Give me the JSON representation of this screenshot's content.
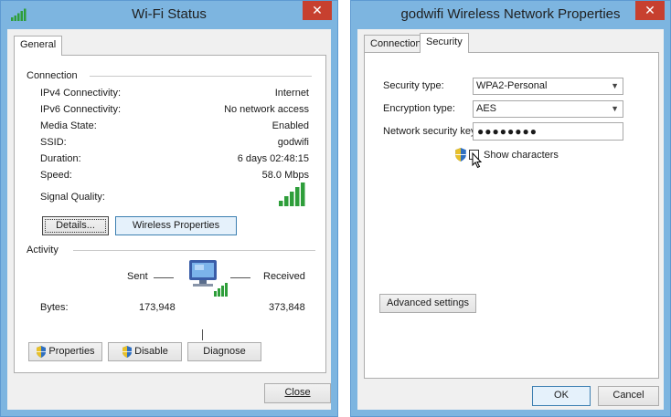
{
  "wifi_status": {
    "title": "Wi-Fi Status",
    "close_glyph": "✕",
    "tabs": [
      {
        "label": "General"
      }
    ],
    "connection": {
      "heading": "Connection",
      "rows": [
        {
          "label": "IPv4 Connectivity:",
          "value": "Internet"
        },
        {
          "label": "IPv6 Connectivity:",
          "value": "No network access"
        },
        {
          "label": "Media State:",
          "value": "Enabled"
        },
        {
          "label": "SSID:",
          "value": "godwifi"
        },
        {
          "label": "Duration:",
          "value": "6 days 02:48:15"
        },
        {
          "label": "Speed:",
          "value": "58.0 Mbps"
        }
      ],
      "signal_label": "Signal Quality:",
      "signal_level": 5,
      "signal_max": 5
    },
    "buttons": {
      "details": "Details...",
      "wireless_properties": "Wireless Properties"
    },
    "activity": {
      "heading": "Activity",
      "sent_label": "Sent",
      "received_label": "Received",
      "bytes_label": "Bytes:",
      "bytes_sent": "173,948",
      "bytes_received": "373,848"
    },
    "actions": {
      "properties": "Properties",
      "disable": "Disable",
      "diagnose": "Diagnose"
    },
    "close_button": "Close"
  },
  "wireless_properties": {
    "title": "godwifi Wireless Network Properties",
    "close_glyph": "✕",
    "tabs": [
      {
        "label": "Connection",
        "active": false
      },
      {
        "label": "Security",
        "active": true
      }
    ],
    "security_type_label": "Security type:",
    "security_type_value": "WPA2-Personal",
    "encryption_type_label": "Encryption type:",
    "encryption_type_value": "AES",
    "network_key_label": "Network security key",
    "network_key_value": "●●●●●●●●",
    "show_characters_label": "Show characters",
    "show_characters_checked": false,
    "advanced_settings": "Advanced settings",
    "ok_button": "OK",
    "cancel_button": "Cancel"
  },
  "colors": {
    "window_frame": "#7db5e0",
    "close_button": "#c7402f",
    "signal_green": "#2e9e3a",
    "panel_bg": "#f0f0f0"
  },
  "icons": {
    "signal": "signal-strength-icon",
    "network": "network-computer-icon",
    "shield": "uac-shield-icon",
    "cursor": "mouse-pointer-icon"
  }
}
